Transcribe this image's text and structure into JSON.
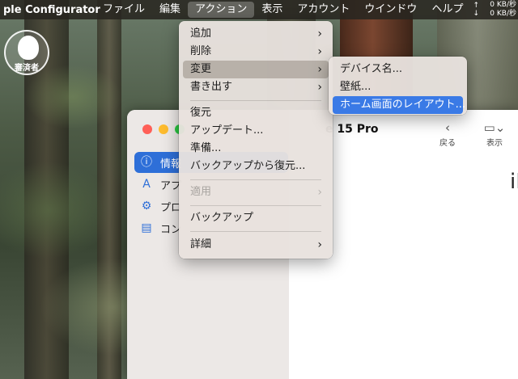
{
  "menubar": {
    "app_name": "ple Configurator",
    "items": [
      "ファイル",
      "編集",
      "アクション",
      "表示",
      "アカウント",
      "ウインドウ",
      "ヘルプ"
    ],
    "net_up": "0 KB/秒",
    "net_down": "0 KB/秒"
  },
  "watermark": {
    "text": "審済者"
  },
  "sidebar": {
    "items": [
      {
        "label": "情報",
        "icon": "info-icon"
      },
      {
        "label": "アプ",
        "icon": "app-store-icon"
      },
      {
        "label": "プロ",
        "icon": "gear-icon"
      },
      {
        "label": "コン",
        "icon": "console-icon"
      }
    ]
  },
  "main": {
    "device_title": "e 15 Pro",
    "back_label": "戻る",
    "view_label": "表示",
    "side_text": "iF"
  },
  "action_menu": {
    "items": [
      {
        "label": "追加",
        "submenu": true
      },
      {
        "label": "削除",
        "submenu": true
      },
      {
        "label": "変更",
        "submenu": true,
        "state": "highlighted"
      },
      {
        "label": "書き出す",
        "submenu": true
      },
      {
        "label": "復元"
      },
      {
        "label": "アップデート..."
      },
      {
        "label": "準備..."
      },
      {
        "label": "バックアップから復元..."
      },
      {
        "label": "適用",
        "submenu": true,
        "state": "disabled"
      },
      {
        "label": "バックアップ"
      },
      {
        "label": "詳細",
        "submenu": true
      }
    ]
  },
  "change_submenu": {
    "items": [
      {
        "label": "デバイス名..."
      },
      {
        "label": "壁紙..."
      },
      {
        "label": "ホーム画面のレイアウト...",
        "state": "selected"
      }
    ]
  },
  "colors": {
    "selection_blue": "#3a7ae6",
    "sidebar_selected": "#2e6fd8"
  }
}
